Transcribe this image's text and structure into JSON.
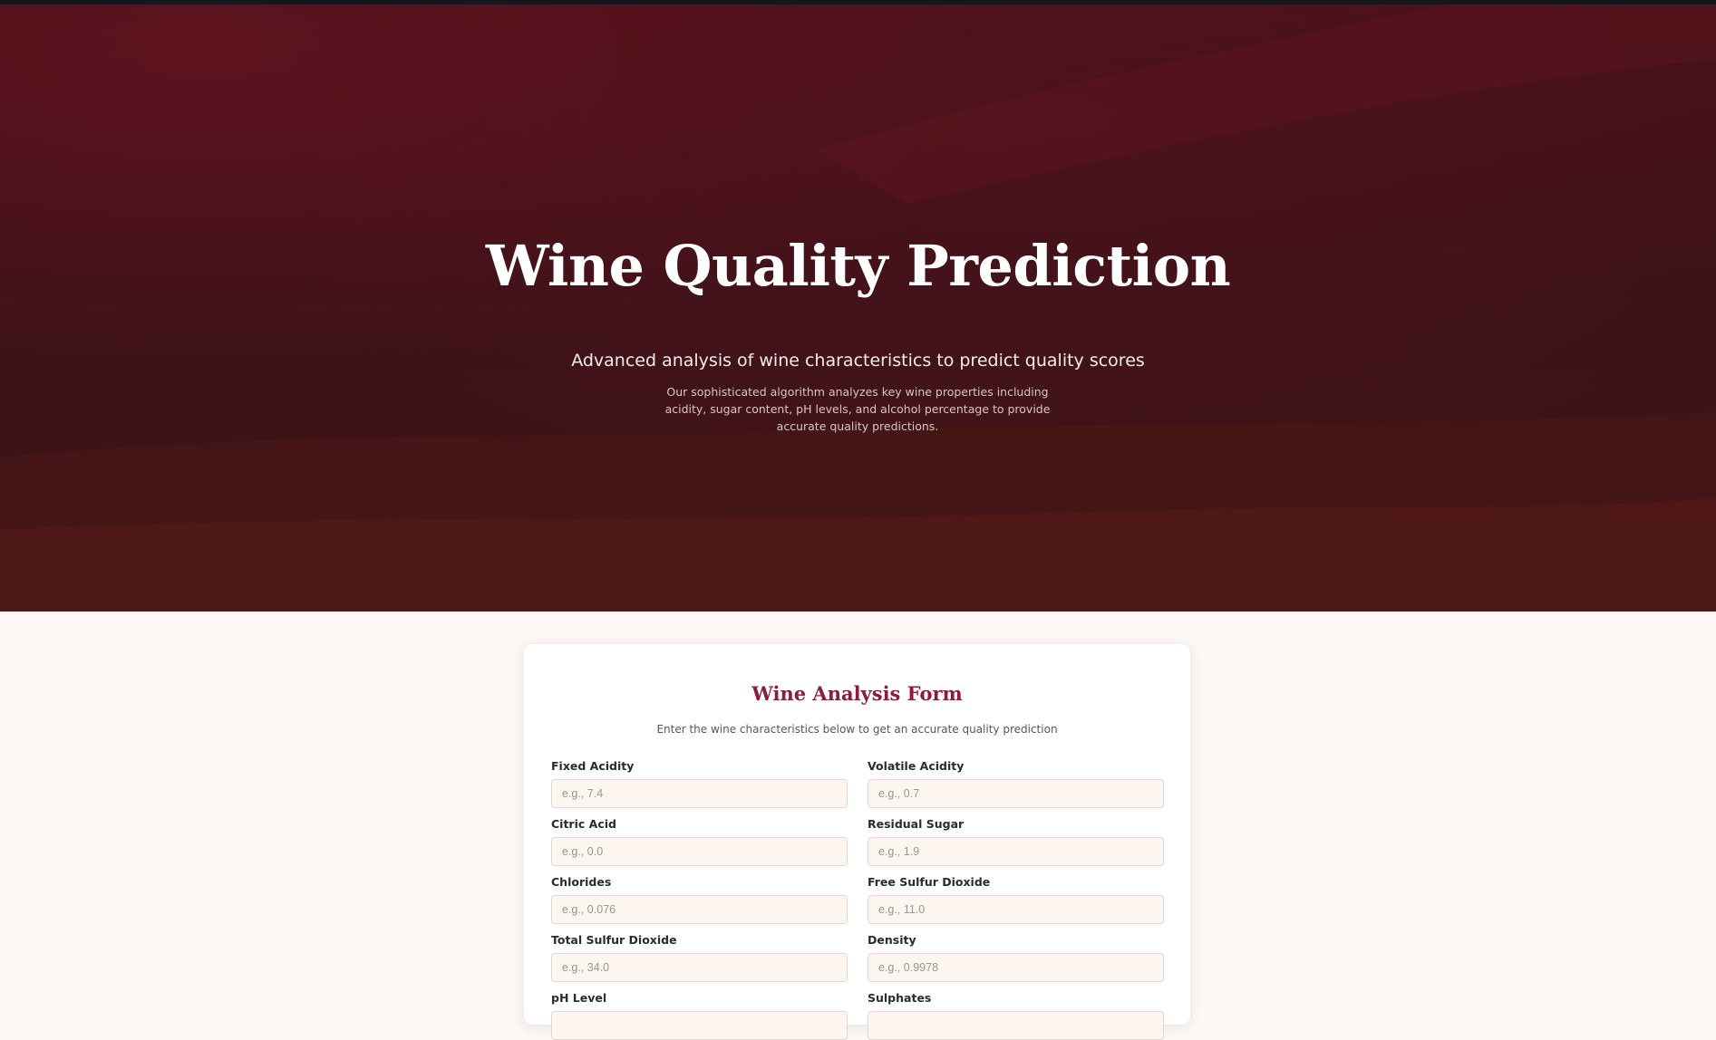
{
  "hero": {
    "title": "Wine Quality Prediction",
    "subtitle": "Advanced analysis of wine characteristics to predict quality scores",
    "description": "Our sophisticated algorithm analyzes key wine properties including acidity, sugar content, pH levels, and alcohol percentage to provide accurate quality predictions."
  },
  "form": {
    "title": "Wine Analysis Form",
    "description": "Enter the wine characteristics below to get an accurate quality prediction",
    "fields": [
      {
        "label": "Fixed Acidity",
        "placeholder": "e.g., 7.4",
        "value": ""
      },
      {
        "label": "Volatile Acidity",
        "placeholder": "e.g., 0.7",
        "value": ""
      },
      {
        "label": "Citric Acid",
        "placeholder": "e.g., 0.0",
        "value": ""
      },
      {
        "label": "Residual Sugar",
        "placeholder": "e.g., 1.9",
        "value": ""
      },
      {
        "label": "Chlorides",
        "placeholder": "e.g., 0.076",
        "value": ""
      },
      {
        "label": "Free Sulfur Dioxide",
        "placeholder": "e.g., 11.0",
        "value": ""
      },
      {
        "label": "Total Sulfur Dioxide",
        "placeholder": "e.g., 34.0",
        "value": ""
      },
      {
        "label": "Density",
        "placeholder": "e.g., 0.9978",
        "value": ""
      },
      {
        "label": "pH Level",
        "placeholder": "",
        "value": ""
      },
      {
        "label": "Sulphates",
        "placeholder": "",
        "value": ""
      }
    ]
  },
  "colors": {
    "hero_background": "#3e1219",
    "accent": "#8a1d3b",
    "page_background": "#fcf8f5",
    "input_background": "#fdf6f0"
  }
}
